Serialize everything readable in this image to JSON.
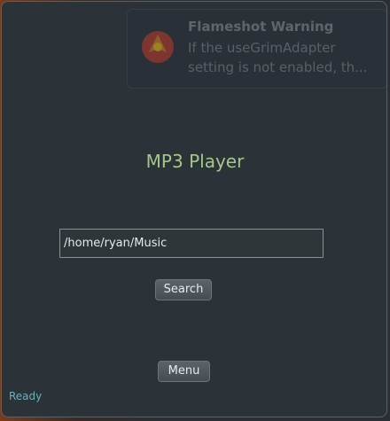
{
  "notification": {
    "title": "Flameshot Warning",
    "body_line1": "If the useGrimAdapter",
    "body_line2": "setting is not enabled, th..."
  },
  "app": {
    "title": "MP3 Player",
    "path_value": "/home/ryan/Music",
    "search_label": "Search",
    "menu_label": "Menu",
    "status": "Ready"
  },
  "colors": {
    "window_bg": "#2b3238",
    "title_green": "#a4c68a",
    "status_teal": "#6fb0b8"
  },
  "icons": {
    "notification": "flameshot-icon"
  }
}
